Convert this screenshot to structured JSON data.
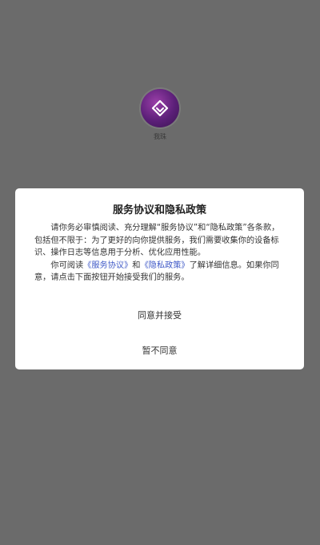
{
  "splash": {
    "app_name": "我珠"
  },
  "dialog": {
    "title": "服务协议和隐私政策",
    "paragraph1": "请你务必审慎阅读、充分理解“服务协议”和“隐私政策”各条款，包括但不限于：为了更好的向你提供服务，我们需要收集你的设备标识、操作日志等信息用于分析、优化应用性能。",
    "paragraph2_prefix": "你可阅读",
    "service_agreement_link": "《服务协议》",
    "and_text": "和",
    "privacy_policy_link": "《隐私政策》",
    "paragraph2_suffix": "了解详细信息。如果你同意，请点击下面按钮开始接受我们的服务。",
    "agree_button": "同意并接受",
    "disagree_button": "暂不同意"
  },
  "colors": {
    "overlay": "#6b6b6b",
    "link": "#3f59c7",
    "logo": "#5b1f78"
  }
}
